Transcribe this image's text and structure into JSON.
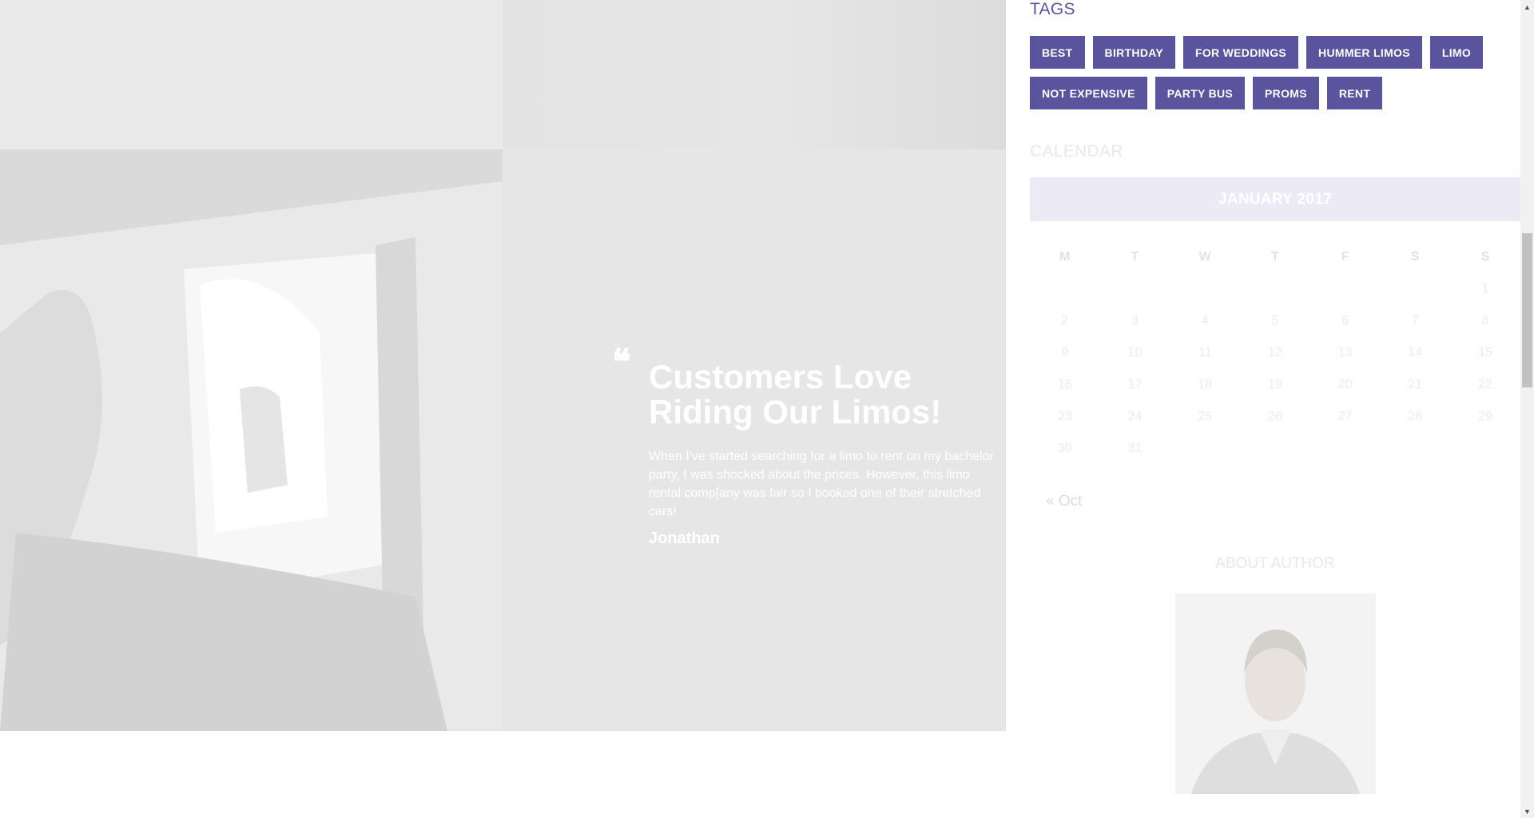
{
  "testimonial": {
    "quote_icon": "quote-icon",
    "heading": "Customers Love Riding Our Limos!",
    "text": "When I've started searching for a limo to rent on my bachelor party, I was shocked about the prices. However, this limo rental comp[any was fair so I booked one of their stretched cars!",
    "author": "Jonathan"
  },
  "sidebar": {
    "tags_title": "TAGS",
    "tags_row1": [
      "BEST",
      "BIRTHDAY",
      "FOR WEDDINGS",
      "HUMMER LIMOS",
      "LIMO"
    ],
    "tags_row2": [
      "NOT EXPENSIVE",
      "PARTY BUS",
      "PROMS",
      "RENT"
    ],
    "calendar_title": "CALENDAR",
    "calendar": {
      "month": "JANUARY 2017",
      "weekdays": [
        "M",
        "T",
        "W",
        "T",
        "F",
        "S",
        "S"
      ],
      "weeks": [
        [
          "",
          "",
          "",
          "",
          "",
          "",
          "1"
        ],
        [
          "2",
          "3",
          "4",
          "5",
          "6",
          "7",
          "8"
        ],
        [
          "9",
          "10",
          "11",
          "12",
          "13",
          "14",
          "15"
        ],
        [
          "16",
          "17",
          "18",
          "19",
          "20",
          "21",
          "22"
        ],
        [
          "23",
          "24",
          "25",
          "26",
          "27",
          "28",
          "29"
        ],
        [
          "30",
          "31",
          "",
          "",
          "",
          "",
          ""
        ]
      ],
      "prev_link": "« Oct"
    },
    "about_title": "ABOUT AUTHOR"
  },
  "colors": {
    "accent": "#5a549f",
    "hero_bg": "#e6e6e6"
  }
}
